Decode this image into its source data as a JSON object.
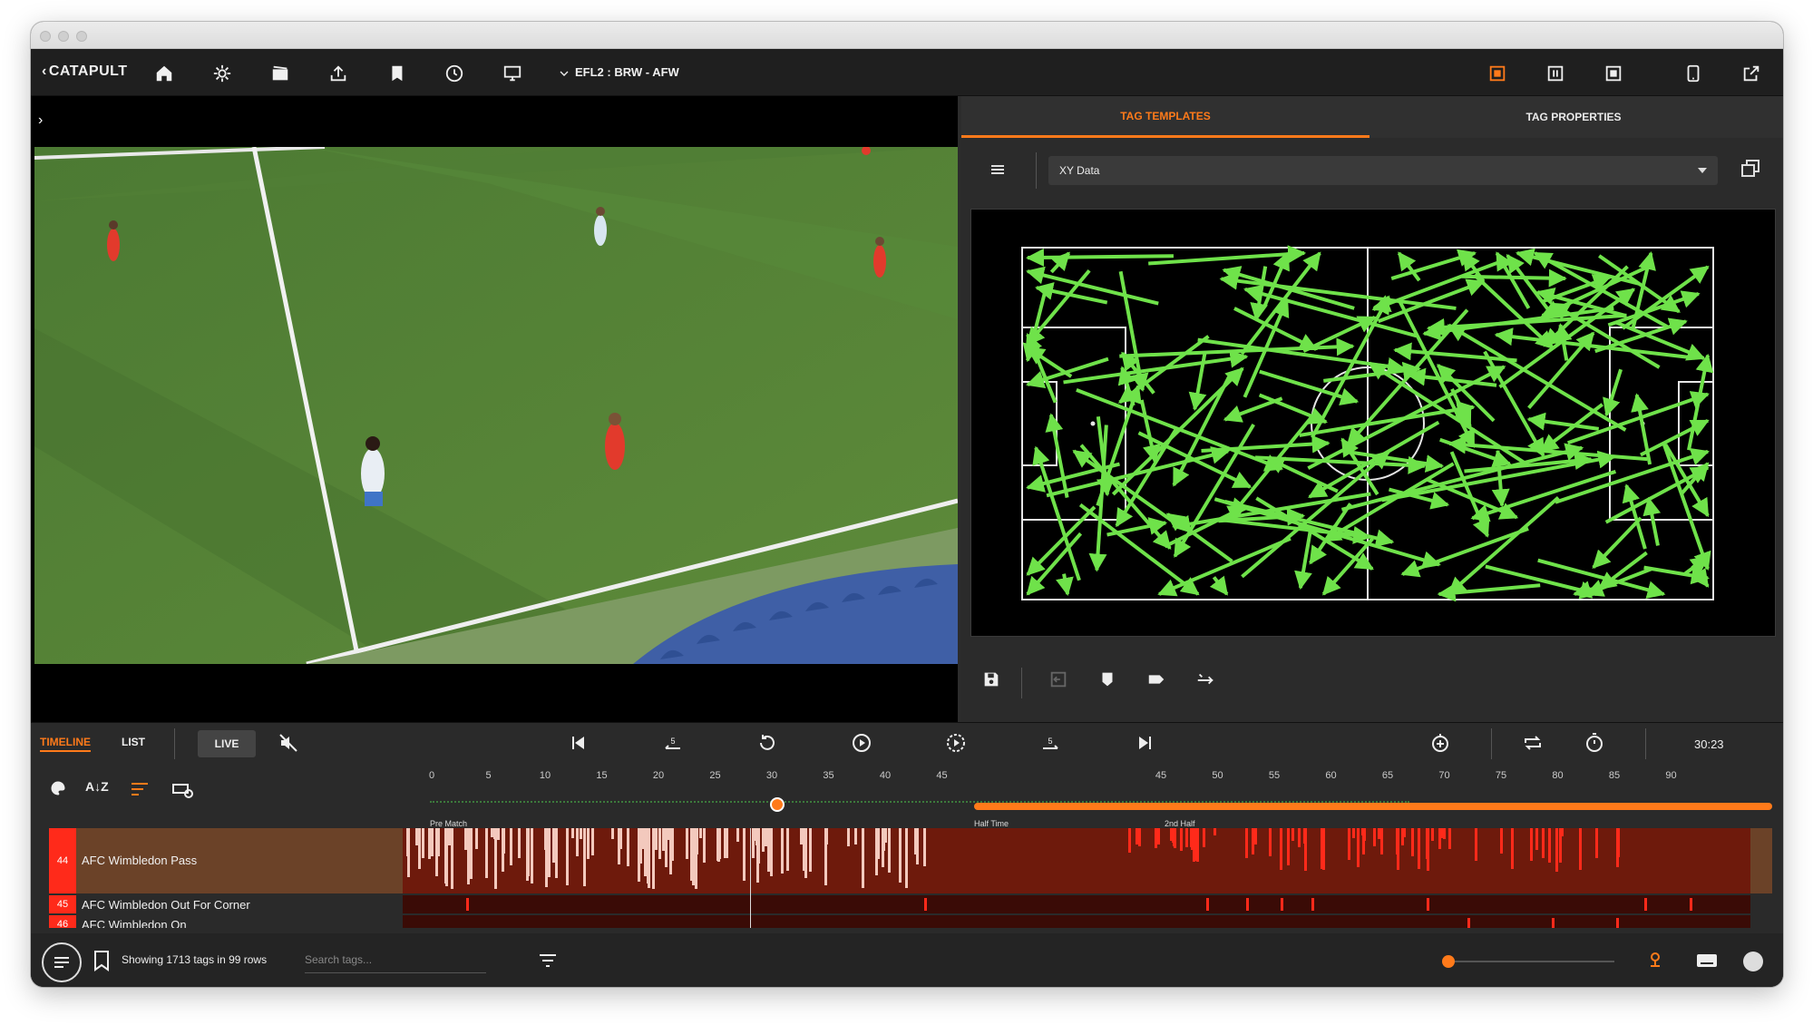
{
  "toolbar": {
    "logo": "CATAPULT",
    "match_title": "EFL2 : BRW - AFW"
  },
  "right_panel": {
    "tabs": [
      {
        "label": "TAG TEMPLATES",
        "active": true
      },
      {
        "label": "TAG PROPERTIES",
        "active": false
      }
    ],
    "template_select": {
      "value": "XY Data"
    }
  },
  "bottom": {
    "view_tabs": [
      {
        "label": "TIMELINE",
        "active": true
      },
      {
        "label": "LIST",
        "active": false
      }
    ],
    "live_label": "LIVE",
    "clock": "30:23",
    "first_half_ticks": [
      "0",
      "5",
      "10",
      "15",
      "20",
      "25",
      "30",
      "35",
      "40",
      "45"
    ],
    "second_half_ticks": [
      "45",
      "50",
      "55",
      "60",
      "65",
      "70",
      "75",
      "80",
      "85",
      "90"
    ],
    "phases": {
      "pre_match": "Pre Match",
      "half_time": "Half Time",
      "second_half": "2nd Half"
    },
    "playhead_fraction": 0.259,
    "rows": [
      {
        "num": "44",
        "label": "AFC Wimbledon Pass"
      },
      {
        "num": "45",
        "label": "AFC Wimbledon Out For Corner"
      },
      {
        "num": "46",
        "label": "AFC Wimbledon On"
      }
    ],
    "status_text": "Showing 1713 tags in 99 rows",
    "search_placeholder": "Search tags..."
  },
  "colors": {
    "accent": "#ff7a1a",
    "arrow": "#6fe24a",
    "row_number": "#ff2a1a",
    "event_mark_first_half": "#f3c9bd",
    "event_mark_second_half": "#ff2a1a"
  }
}
